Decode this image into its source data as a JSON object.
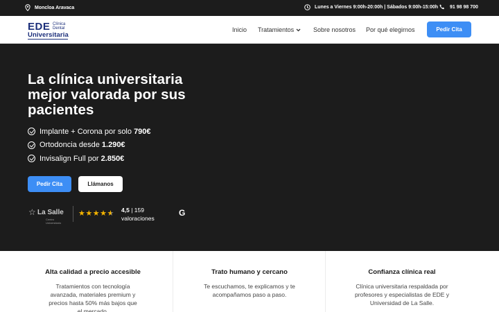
{
  "topbar": {
    "location": "Moncloa Aravaca",
    "hours": "Lunes a Viernes 9:00h-20:00h | Sábados 9:00h-15:00h",
    "phone": "91 98 98 700"
  },
  "logo": {
    "main": "EDE",
    "line1": "Clínica",
    "line2": "Dental",
    "line3": "Universitaria"
  },
  "nav": {
    "items": [
      "Inicio",
      "Tratamientos",
      "Sobre nosotros",
      "Por qué elegirnos"
    ],
    "cta": "Pedir Cita"
  },
  "hero": {
    "title": "La clínica universitaria mejor valorada por sus pacientes",
    "features": [
      {
        "text": "Implante + Corona por solo",
        "price": "790€"
      },
      {
        "text": "Ortodoncia desde",
        "price": "1.290€"
      },
      {
        "text": "Invisalign Full por",
        "price": "2.850€"
      }
    ],
    "primary_button": "Pedir Cita",
    "secondary_button": "Llámanos",
    "partner": {
      "name": "La Salle",
      "sub": "Centro Universitario"
    },
    "rating": {
      "score": "4,5",
      "count": "159",
      "label": "valoraciones",
      "stars": 4.5
    }
  },
  "cards": [
    {
      "title": "Alta calidad a precio accesible",
      "text": "Tratamientos con tecnología avanzada, materiales premium y precios hasta 50% más bajos que el mercado."
    },
    {
      "title": "Trato humano y cercano",
      "text": "Te escuchamos, te explicamos y te acompañamos paso a paso."
    },
    {
      "title": "Confianza clínica real",
      "text": "Clínica universitaria respaldada por profesores y especialistas de EDE y Universidad de La Salle."
    }
  ],
  "colors": {
    "accent": "#3d8ef5",
    "dark": "#1c1c1c",
    "brand": "#1b2e7a",
    "stars": "#f5b400"
  }
}
